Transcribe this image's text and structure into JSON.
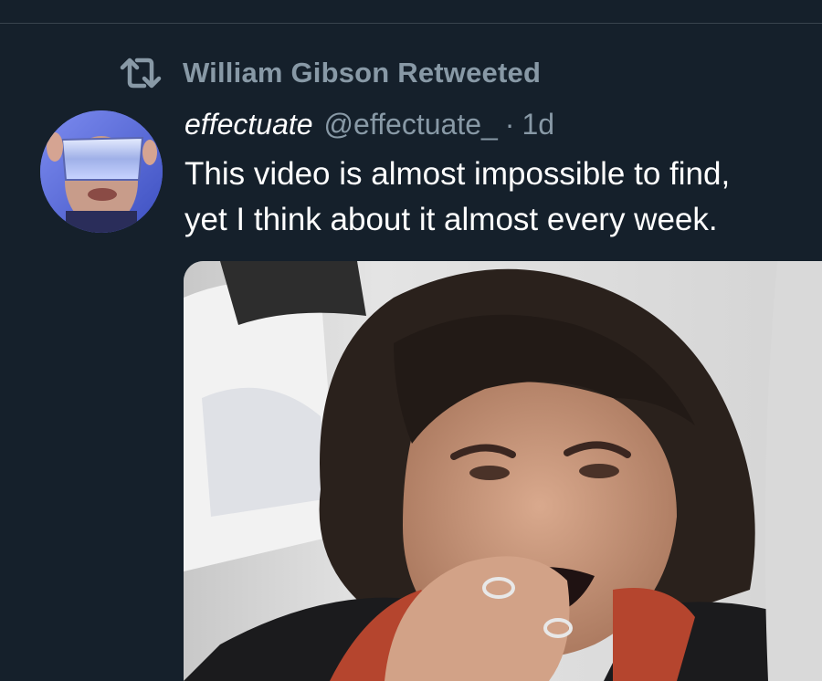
{
  "retweet": {
    "icon": "retweet-icon",
    "label": "William Gibson Retweeted"
  },
  "tweet": {
    "avatar_icon": "avatar-image",
    "display_name": "effectuate",
    "handle": "@effectuate_",
    "separator": "·",
    "timestamp": "1d",
    "text_lines": [
      "This video is almost impossible to find,",
      "yet I think about it almost every week."
    ],
    "media_icon": "video-thumbnail-image"
  },
  "colors": {
    "background": "#15202b",
    "primary_text": "#ffffff",
    "secondary_text": "#8899a6",
    "divider": "#38444d"
  }
}
